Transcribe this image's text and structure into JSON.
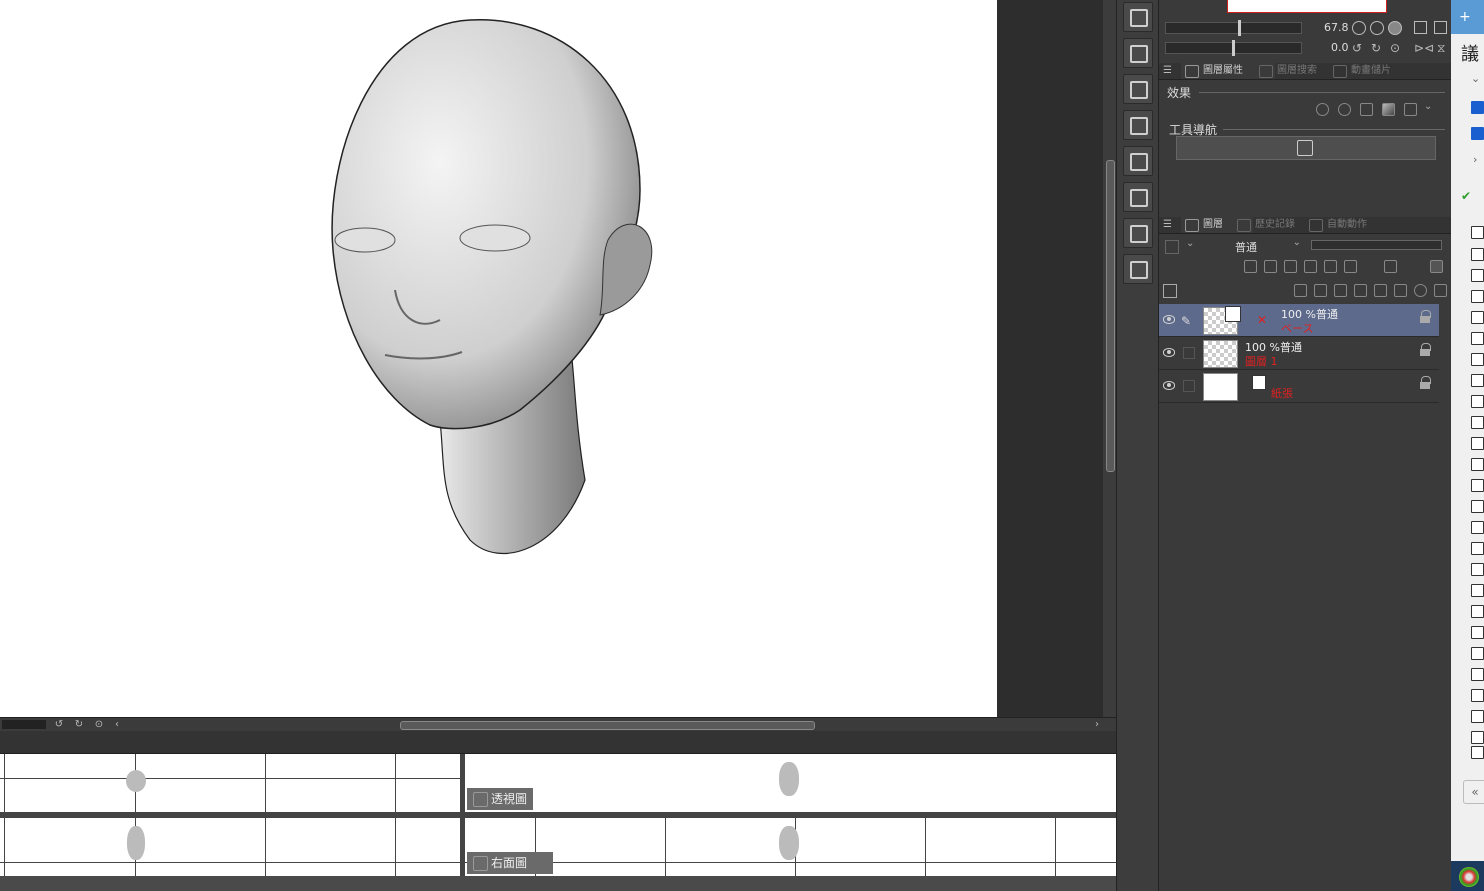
{
  "navigator": {
    "zoom_value": "67.8",
    "rotate_value": "0.0"
  },
  "layer_property_panel": {
    "tabs": [
      {
        "label": "圖層屬性"
      },
      {
        "label": "圖層搜索"
      },
      {
        "label": "動畫儲片"
      }
    ],
    "effect_label": "效果",
    "tool_nav_label": "工具導航"
  },
  "layer_panel": {
    "tabs": [
      {
        "label": "圖層"
      },
      {
        "label": "歷史記錄"
      },
      {
        "label": "自動動作"
      }
    ],
    "blend_mode": "普通",
    "layers": [
      {
        "top": "100 %普通",
        "name": "ベース",
        "selected": true
      },
      {
        "top": "100 %普通",
        "name": "圖層 1",
        "selected": false
      },
      {
        "top": "",
        "name": "紙張",
        "selected": false
      }
    ]
  },
  "views": {
    "perspective_label": "透視圖",
    "right_label": "右面圖"
  },
  "sliver": {
    "title_char": "議",
    "plus": "+",
    "back": "«"
  },
  "colors": {
    "selected_layer": "#5d6a8c",
    "layer_name_red": "#e02020",
    "accent_blue": "#1a5fd0"
  }
}
